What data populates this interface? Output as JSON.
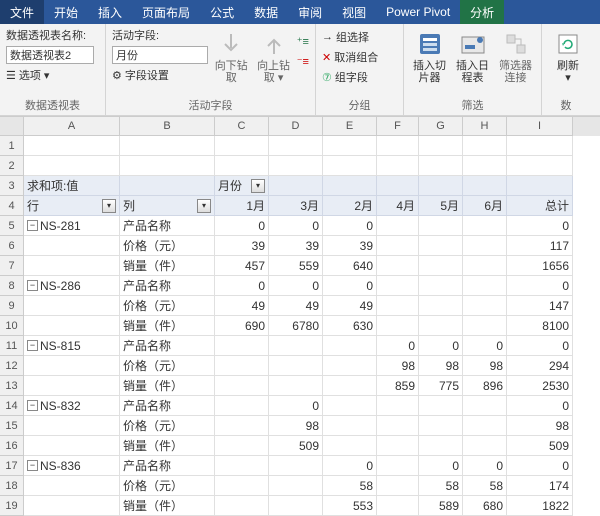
{
  "tabs": {
    "file": "文件",
    "home": "开始",
    "insert": "插入",
    "layout": "页面布局",
    "formulas": "公式",
    "data": "数据",
    "review": "审阅",
    "view": "视图",
    "powerpivot": "Power Pivot",
    "analyze": "分析"
  },
  "ribbon": {
    "pt_name_label": "数据透视表名称:",
    "pt_name_value": "数据透视表2",
    "options": "选项",
    "group_pt": "数据透视表",
    "active_field_label": "活动字段:",
    "active_field_value": "月份",
    "field_settings": "字段设置",
    "drill_down": "向下钻取",
    "drill_up": "向上钻取",
    "group_active": "活动字段",
    "group_selection": "组选择",
    "ungroup": "取消组合",
    "group_field": "组字段",
    "group_group": "分组",
    "insert_slicer": "插入切片器",
    "insert_timeline": "插入日程表",
    "filter_conn": "筛选器连接",
    "group_filter": "筛选",
    "refresh": "刷新",
    "group_data": "数"
  },
  "colheaders": [
    "A",
    "B",
    "C",
    "D",
    "E",
    "F",
    "G",
    "H",
    "I"
  ],
  "pivot": {
    "sum_label": "求和项:值",
    "row_label": "行",
    "col_label": "列",
    "month_label": "月份",
    "months": [
      "1月",
      "3月",
      "2月",
      "4月",
      "5月",
      "6月"
    ],
    "total": "总计"
  },
  "rows": [
    {
      "n": 1,
      "cells": [
        "",
        "",
        "",
        "",
        "",
        "",
        "",
        "",
        ""
      ]
    },
    {
      "n": 2,
      "cells": [
        "",
        "",
        "",
        "",
        "",
        "",
        "",
        "",
        ""
      ]
    },
    {
      "n": 3,
      "h": true,
      "a": "求和项:值",
      "b": "",
      "cfilter": "月份"
    },
    {
      "n": 4,
      "h": true,
      "a": "行",
      "afilter": true,
      "b": "列",
      "bfilter": true,
      "c": "1月",
      "d": "3月",
      "e": "2月",
      "f": "4月",
      "g": "5月",
      "h6": "6月",
      "i": "总计"
    },
    {
      "n": 5,
      "collapse": true,
      "a": "NS-281",
      "b": "产品名称",
      "c": "0",
      "d": "0",
      "e": "0",
      "i": "0",
      "num": true
    },
    {
      "n": 6,
      "b": "价格（元）",
      "c": "39",
      "d": "39",
      "e": "39",
      "i": "117",
      "num": true
    },
    {
      "n": 7,
      "b": "销量（件）",
      "c": "457",
      "d": "559",
      "e": "640",
      "i": "1656",
      "num": true
    },
    {
      "n": 8,
      "collapse": true,
      "a": "NS-286",
      "b": "产品名称",
      "c": "0",
      "d": "0",
      "e": "0",
      "i": "0",
      "num": true
    },
    {
      "n": 9,
      "b": "价格（元）",
      "c": "49",
      "d": "49",
      "e": "49",
      "i": "147",
      "num": true
    },
    {
      "n": 10,
      "b": "销量（件）",
      "c": "690",
      "d": "6780",
      "e": "630",
      "i": "8100",
      "num": true
    },
    {
      "n": 11,
      "collapse": true,
      "a": "NS-815",
      "b": "产品名称",
      "f": "0",
      "g": "0",
      "h6": "0",
      "i": "0",
      "num": true
    },
    {
      "n": 12,
      "b": "价格（元）",
      "f": "98",
      "g": "98",
      "h6": "98",
      "i": "294",
      "num": true
    },
    {
      "n": 13,
      "b": "销量（件）",
      "f": "859",
      "g": "775",
      "h6": "896",
      "i": "2530",
      "num": true
    },
    {
      "n": 14,
      "collapse": true,
      "a": "NS-832",
      "b": "产品名称",
      "d": "0",
      "i": "0",
      "num": true
    },
    {
      "n": 15,
      "b": "价格（元）",
      "d": "98",
      "i": "98",
      "num": true
    },
    {
      "n": 16,
      "b": "销量（件）",
      "d": "509",
      "i": "509",
      "num": true
    },
    {
      "n": 17,
      "collapse": true,
      "a": "NS-836",
      "b": "产品名称",
      "e": "0",
      "g": "0",
      "h6": "0",
      "i": "0",
      "num": true
    },
    {
      "n": 18,
      "b": "价格（元）",
      "e": "58",
      "g": "58",
      "h6": "58",
      "i": "174",
      "num": true
    },
    {
      "n": 19,
      "b": "销量（件）",
      "e": "553",
      "g": "589",
      "h6": "680",
      "i": "1822",
      "num": true
    }
  ]
}
